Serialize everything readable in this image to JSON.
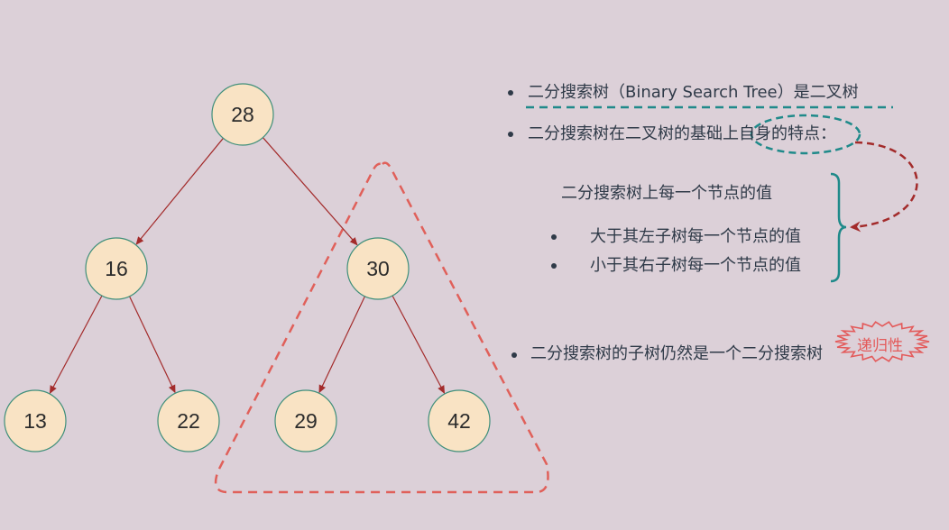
{
  "tree": {
    "nodes": [
      {
        "id": "n28",
        "value": "28"
      },
      {
        "id": "n16",
        "value": "16"
      },
      {
        "id": "n30",
        "value": "30"
      },
      {
        "id": "n13",
        "value": "13"
      },
      {
        "id": "n22",
        "value": "22"
      },
      {
        "id": "n29",
        "value": "29"
      },
      {
        "id": "n42",
        "value": "42"
      }
    ],
    "edges": [
      [
        "n28",
        "n16"
      ],
      [
        "n28",
        "n30"
      ],
      [
        "n16",
        "n13"
      ],
      [
        "n16",
        "n22"
      ],
      [
        "n30",
        "n29"
      ],
      [
        "n30",
        "n42"
      ]
    ],
    "highlighted_subtree_root": "n30"
  },
  "notes": {
    "point1": "二分搜索树（Binary Search Tree）是二叉树",
    "point2": "二分搜索树在二叉树的基础上自身的特点：",
    "property_heading": "二分搜索树上每一个节点的值",
    "property_items": [
      "大于其左子树每一个节点的值",
      "小于其右子树每一个节点的值"
    ],
    "point3": "二分搜索树的子树仍然是一个二分搜索树",
    "recursive_stamp": "递归性"
  },
  "colors": {
    "background": "#dcd0d8",
    "node_fill": "#f9e3c4",
    "node_stroke": "#3f8f7a",
    "edge": "#a32b2b",
    "triangle": "#e0605a",
    "teal_underline": "#1f8a8a",
    "dark_red_arrow": "#a32b2b",
    "brace": "#1f8a8a",
    "stamp": "#e35a5a"
  }
}
